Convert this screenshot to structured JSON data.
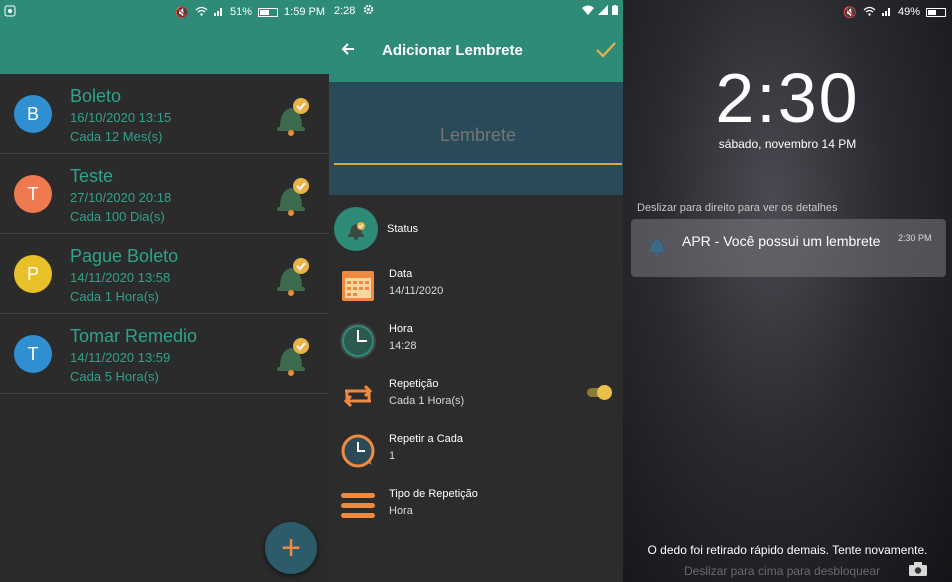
{
  "panel1": {
    "statusbar": {
      "battery": "51%",
      "time": "1:59 PM"
    },
    "items": [
      {
        "initial": "B",
        "avatar_color": "#2f8fd0",
        "title": "Boleto",
        "date": "16/10/2020 13:15",
        "repeat": "Cada 12 Mes(s)"
      },
      {
        "initial": "T",
        "avatar_color": "#f07a50",
        "title": "Teste",
        "date": "27/10/2020 20:18",
        "repeat": "Cada 100 Dia(s)"
      },
      {
        "initial": "P",
        "avatar_color": "#e8c02a",
        "title": "Pague Boleto",
        "date": "14/11/2020 13:58",
        "repeat": "Cada 1 Hora(s)"
      },
      {
        "initial": "T",
        "avatar_color": "#2f8fd0",
        "title": "Tomar Remedio",
        "date": "14/11/2020 13:59",
        "repeat": "Cada 5 Hora(s)"
      }
    ],
    "fab_label": "+"
  },
  "panel2": {
    "statusbar": {
      "time": "2:28"
    },
    "toolbar": {
      "title": "Adicionar Lembrete"
    },
    "input": {
      "placeholder": "Lembrete"
    },
    "status_label": "Status",
    "rows": [
      {
        "label": "Data",
        "value": "14/11/2020"
      },
      {
        "label": "Hora",
        "value": "14:28"
      },
      {
        "label": "Repetição",
        "value": "Cada 1 Hora(s)"
      },
      {
        "label": "Repetir a Cada",
        "value": "1"
      },
      {
        "label": "Tipo de Repetição",
        "value": "Hora"
      }
    ],
    "repeat_toggle_on": true
  },
  "panel3": {
    "statusbar": {
      "battery": "49%"
    },
    "clock": "2:30",
    "date": "sábado, novembro 14 PM",
    "hint": "Deslizar para direito para ver os detalhes",
    "notification": {
      "title": "APR - Você possui um lembrete",
      "time": "2:30 PM"
    },
    "message": "O dedo foi retirado rápido demais. Tente novamente.",
    "unlock_hint": "Deslizar para cima para desbloquear"
  },
  "colors": {
    "teal": "#2e8b78",
    "orange": "#f08a3e",
    "gold": "#e9b24a"
  }
}
